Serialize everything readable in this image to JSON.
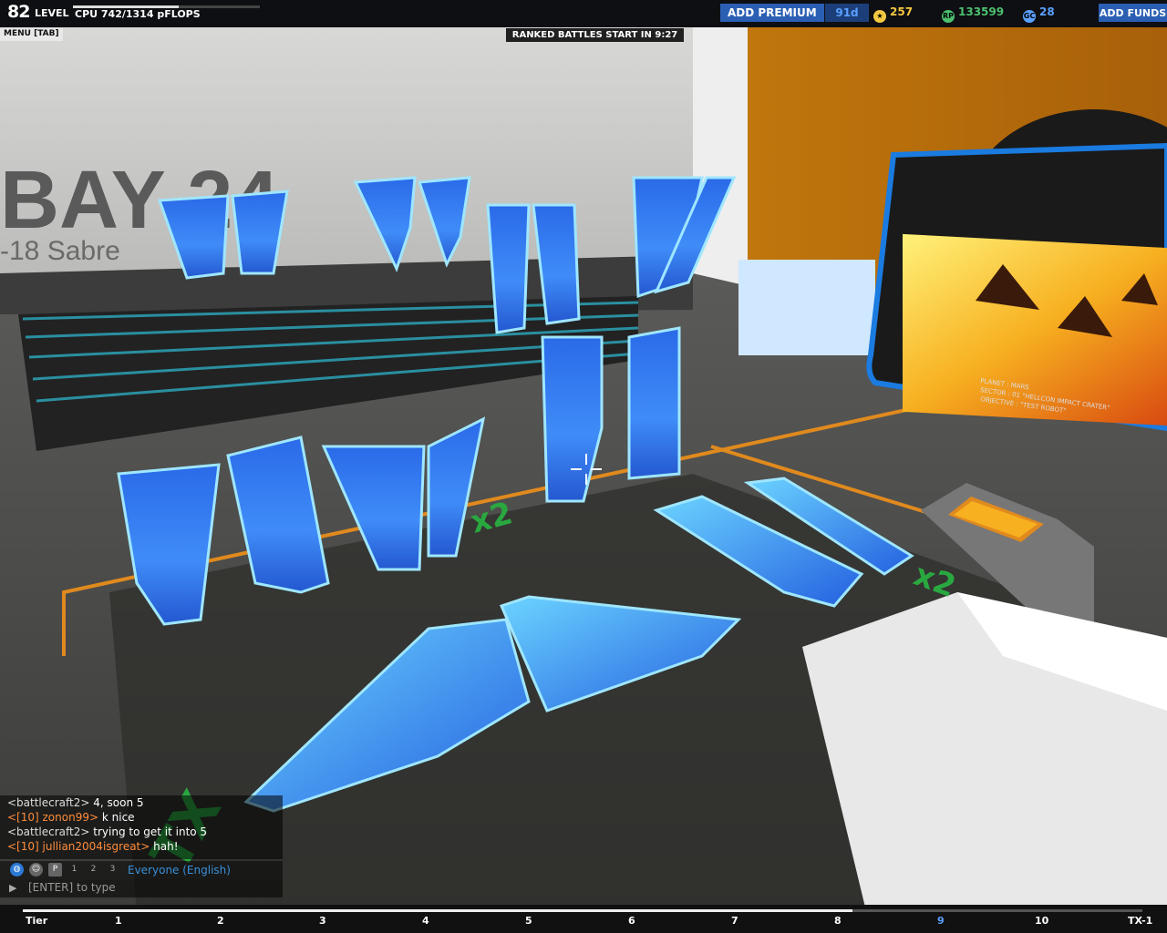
{
  "hud": {
    "level_number": "82",
    "level_label": "LEVEL",
    "cpu_text": "CPU 742/1314 pFLOPS",
    "cpu_fraction": 0.565,
    "add_premium": "ADD PREMIUM",
    "premium_days": "91d",
    "stars": "257",
    "rp_icon": "RP",
    "robits": "133599",
    "gc_icon": "GC",
    "galaxy_coins": "28",
    "add_funds": "ADD FUNDS",
    "menu_tab": "MENU [TAB]",
    "ranked_timer": "RANKED BATTLES START IN 9:27"
  },
  "scene": {
    "bay_text": "BAY 24",
    "bay_sub": "-18 Sabre",
    "x2_label": "x2",
    "monitor_lines": [
      "PLANET : MARS",
      "SECTOR : 01 \"HELLCON IMPACT CRATER\"",
      "OBJECTIVE : \"TEST ROBOT\""
    ]
  },
  "chat": {
    "lines": [
      {
        "name": "<battlecraft2>",
        "msg": "4, soon 5",
        "orange": false
      },
      {
        "name": "<[10] zonon99>",
        "msg": "k nice",
        "orange": true
      },
      {
        "name": "<battlecraft2>",
        "msg": "trying to get it into 5",
        "orange": false
      },
      {
        "name": "<[10] jullian2004isgreat>",
        "msg": "hah!",
        "orange": true
      }
    ],
    "tool_p": "P",
    "tool_1": "1",
    "tool_2": "2",
    "tool_3": "3",
    "channel": "Everyone (English)",
    "input_placeholder": "[ENTER] to type"
  },
  "tiers": {
    "labels": [
      "Tier",
      "1",
      "2",
      "3",
      "4",
      "5",
      "6",
      "7",
      "8",
      "9",
      "10",
      "TX-1"
    ],
    "current": "9"
  },
  "colors": {
    "accent_blue": "#2b5fb3",
    "panel_glow": "#4aa8ff",
    "orange_chat": "#ff8c3a",
    "floor_orange": "#e08a1e"
  }
}
